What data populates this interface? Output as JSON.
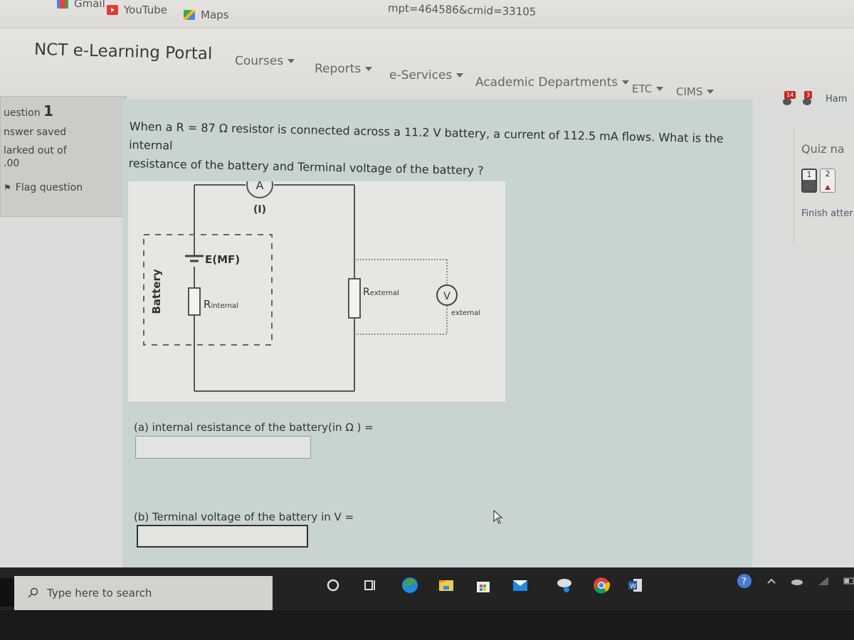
{
  "browser": {
    "bookmarks": [
      {
        "label": "Gmail",
        "icon": "gmail-icon"
      },
      {
        "label": "YouTube",
        "icon": "youtube-icon"
      },
      {
        "label": "Maps",
        "icon": "maps-icon"
      }
    ],
    "url_fragment": "mpt=464586&cmid=33105"
  },
  "navbar": {
    "brand": "NCT e-Learning Portal",
    "menu": [
      {
        "label": "Courses"
      },
      {
        "label": "Reports"
      },
      {
        "label": "e-Services"
      },
      {
        "label": "Academic Departments"
      },
      {
        "label": "ETC"
      },
      {
        "label": "CIMS"
      }
    ],
    "notifications": {
      "count": "14"
    },
    "messages": {
      "count": "3"
    },
    "user_name": "Ham"
  },
  "question_info": {
    "question_label": "uestion",
    "question_number": "1",
    "status": "nswer saved",
    "marked_label": "larked out of",
    "marked_value": ".00",
    "flag_label": "Flag question"
  },
  "question": {
    "line1": "When a R = 87 Ω resistor is connected across a 11.2 V battery, a current of 112.5 mA flows. What is the internal",
    "line2": "resistance of the battery and Terminal voltage of the battery ?",
    "diagram": {
      "ammeter": "A",
      "current_label": "(I)",
      "emf_label": "E(MF)",
      "r_internal": "R",
      "r_internal_sub": "internal",
      "r_external": "R",
      "r_external_sub": "external",
      "voltmeter": "V",
      "voltmeter_sub": "external",
      "battery_label": "Battery"
    },
    "part_a_label": "(a) internal resistance of the battery(in Ω ) =",
    "part_a_value": "",
    "part_b_label": "(b) Terminal voltage of the battery in V =",
    "part_b_value": ""
  },
  "quiz_nav": {
    "title": "Quiz na",
    "buttons": [
      {
        "label": "1",
        "state": "answered"
      },
      {
        "label": "2",
        "state": "flagged"
      }
    ],
    "finish_label": "Finish atter"
  },
  "taskbar": {
    "search_placeholder": "Type here to search",
    "apps": [
      "cortana-icon",
      "task-view-icon",
      "edge-icon",
      "file-explorer-icon",
      "store-icon",
      "mail-icon",
      "snip-icon",
      "chrome-icon",
      "word-icon"
    ]
  }
}
